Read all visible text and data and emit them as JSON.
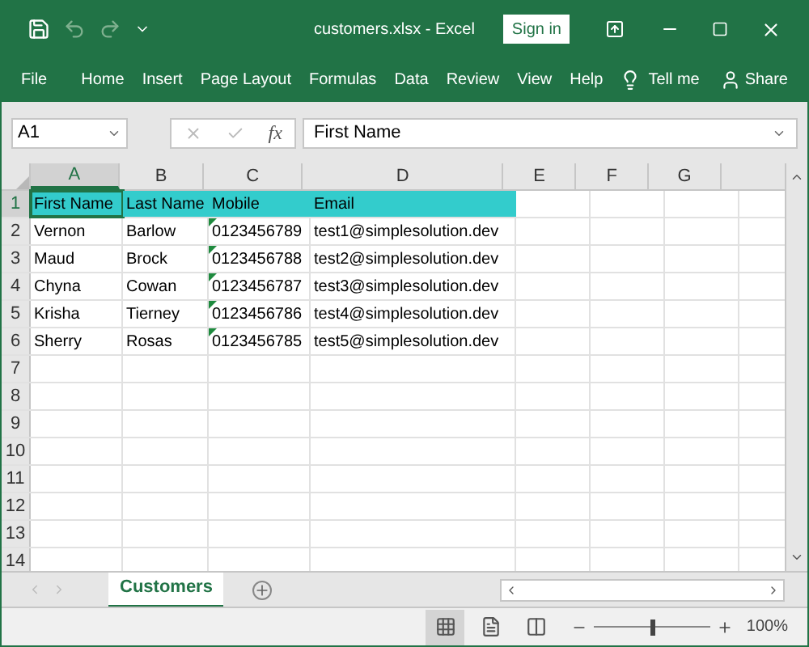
{
  "window": {
    "title": "customers.xlsx - Excel",
    "sign_in": "Sign in"
  },
  "quick_access": [
    {
      "kind": "save",
      "disabled": false
    },
    {
      "kind": "undo",
      "disabled": true
    },
    {
      "kind": "redo",
      "disabled": true
    },
    {
      "kind": "customize",
      "disabled": false
    }
  ],
  "ribbon_tabs": [
    "File",
    "Home",
    "Insert",
    "Page Layout",
    "Formulas",
    "Data",
    "Review",
    "View",
    "Help"
  ],
  "tell_me": "Tell me",
  "share": "Share",
  "formula_bar": {
    "name_box": "A1",
    "fx": "fx",
    "value": "First Name"
  },
  "sheet": {
    "columns": [
      "A",
      "B",
      "C",
      "D",
      "E",
      "F",
      "G"
    ],
    "rows": [
      {
        "number": "1",
        "cells": [
          {
            "text": "First Name",
            "selected": true,
            "highlighted": true,
            "flagged": false
          },
          {
            "text": "Last Name",
            "selected": false,
            "highlighted": true,
            "flagged": false
          },
          {
            "text": "Mobile",
            "selected": false,
            "highlighted": true,
            "flagged": false
          },
          {
            "text": "Email",
            "selected": false,
            "highlighted": true,
            "flagged": false
          }
        ]
      },
      {
        "number": "2",
        "cells": [
          {
            "text": "Vernon",
            "selected": false,
            "highlighted": false,
            "flagged": false
          },
          {
            "text": "Barlow",
            "selected": false,
            "highlighted": false,
            "flagged": false
          },
          {
            "text": "0123456789",
            "selected": false,
            "highlighted": false,
            "flagged": true
          },
          {
            "text": "test1@simplesolution.dev",
            "selected": false,
            "highlighted": false,
            "flagged": false
          }
        ]
      },
      {
        "number": "3",
        "cells": [
          {
            "text": "Maud",
            "selected": false,
            "highlighted": false,
            "flagged": false
          },
          {
            "text": "Brock",
            "selected": false,
            "highlighted": false,
            "flagged": false
          },
          {
            "text": "0123456788",
            "selected": false,
            "highlighted": false,
            "flagged": true
          },
          {
            "text": "test2@simplesolution.dev",
            "selected": false,
            "highlighted": false,
            "flagged": false
          }
        ]
      },
      {
        "number": "4",
        "cells": [
          {
            "text": "Chyna",
            "selected": false,
            "highlighted": false,
            "flagged": false
          },
          {
            "text": "Cowan",
            "selected": false,
            "highlighted": false,
            "flagged": false
          },
          {
            "text": "0123456787",
            "selected": false,
            "highlighted": false,
            "flagged": true
          },
          {
            "text": "test3@simplesolution.dev",
            "selected": false,
            "highlighted": false,
            "flagged": false
          }
        ]
      },
      {
        "number": "5",
        "cells": [
          {
            "text": "Krisha",
            "selected": false,
            "highlighted": false,
            "flagged": false
          },
          {
            "text": "Tierney",
            "selected": false,
            "highlighted": false,
            "flagged": false
          },
          {
            "text": "0123456786",
            "selected": false,
            "highlighted": false,
            "flagged": true
          },
          {
            "text": "test4@simplesolution.dev",
            "selected": false,
            "highlighted": false,
            "flagged": false
          }
        ]
      },
      {
        "number": "6",
        "cells": [
          {
            "text": "Sherry",
            "selected": false,
            "highlighted": false,
            "flagged": false
          },
          {
            "text": "Rosas",
            "selected": false,
            "highlighted": false,
            "flagged": false
          },
          {
            "text": "0123456785",
            "selected": false,
            "highlighted": false,
            "flagged": true
          },
          {
            "text": "test5@simplesolution.dev",
            "selected": false,
            "highlighted": false,
            "flagged": false
          }
        ]
      },
      {
        "number": "7"
      },
      {
        "number": "8"
      },
      {
        "number": "9"
      },
      {
        "number": "10"
      },
      {
        "number": "11"
      },
      {
        "number": "12"
      },
      {
        "number": "13"
      },
      {
        "number": "14"
      }
    ]
  },
  "sheet_tabs": [
    {
      "label": "Customers",
      "selected": true
    }
  ],
  "status_bar": {
    "views": [
      {
        "kind": "normal",
        "selected": true
      },
      {
        "kind": "page_layout",
        "selected": false
      },
      {
        "kind": "page_break",
        "selected": false
      }
    ],
    "zoom": {
      "level": 0.5,
      "reading": "100%"
    }
  }
}
